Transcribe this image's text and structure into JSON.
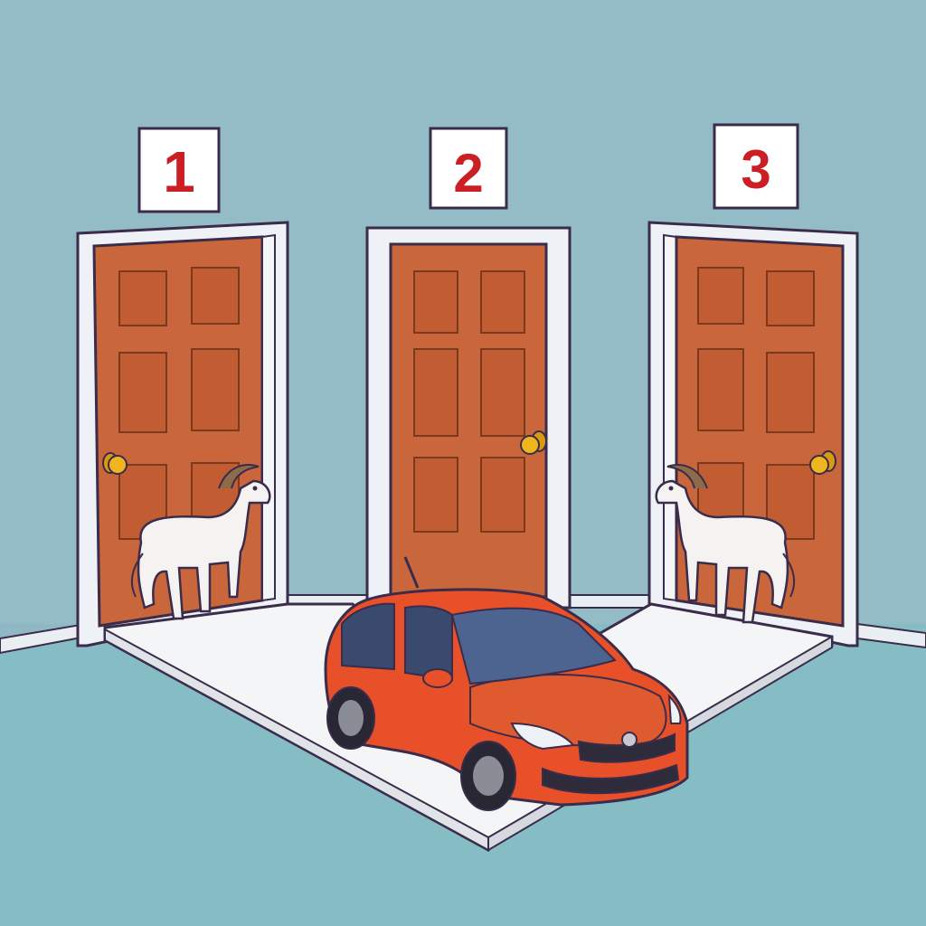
{
  "scene": {
    "doors": [
      {
        "number": "1",
        "behind": "goat"
      },
      {
        "number": "2",
        "behind": "car"
      },
      {
        "number": "3",
        "behind": "goat"
      }
    ],
    "colors": {
      "wall": "#8fb8c4",
      "wall_light": "#a2c7cf",
      "floor": "#86bcc4",
      "door": "#c5643a",
      "door_panel": "#bd5b32",
      "door_frame": "#eef2f6",
      "sign_bg": "#ffffff",
      "sign_number": "#cc1f24",
      "car_body": "#e8502a",
      "platform": "#f4f5f7",
      "goat": "#f4f3f2",
      "knob": "#f0b51e",
      "outline": "#3a2c4a"
    },
    "icons": [
      "goat-icon",
      "car-icon",
      "door-knob-icon"
    ]
  }
}
